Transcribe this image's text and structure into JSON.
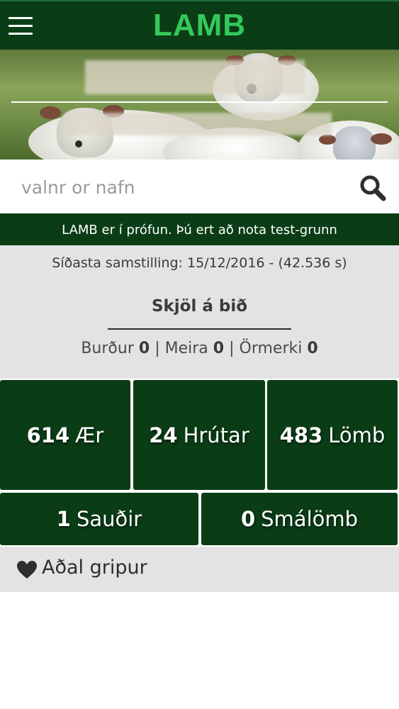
{
  "header": {
    "app_title": "LAMB",
    "menu_icon": "hamburger-menu-icon"
  },
  "search": {
    "placeholder": "valnr or nafn",
    "icon": "search-icon"
  },
  "notice": {
    "text": "LAMB er í prófun. Þú ert að nota test-grunn"
  },
  "sync": {
    "text": "Síðasta samstilling: 15/12/2016 - (42.536 s)"
  },
  "pending_documents": {
    "title": "Skjöl á bið",
    "items": [
      {
        "label": "Burður",
        "count": "0"
      },
      {
        "label": "Meira",
        "count": "0"
      },
      {
        "label": "Örmerki",
        "count": "0"
      }
    ],
    "separator": "|"
  },
  "stats": [
    {
      "count": "614",
      "label": "Ær"
    },
    {
      "count": "24",
      "label": "Hrútar"
    },
    {
      "count": "483",
      "label": "Lömb"
    },
    {
      "count": "1",
      "label": "Sauðir"
    },
    {
      "count": "0",
      "label": "Smálömb"
    }
  ],
  "favorites": {
    "label": "Aðal gripur",
    "icon": "heart-icon"
  },
  "colors": {
    "brand_dark_green": "#0a3d16",
    "title_green": "#35c85a",
    "panel_gray": "#e3e3e3"
  }
}
